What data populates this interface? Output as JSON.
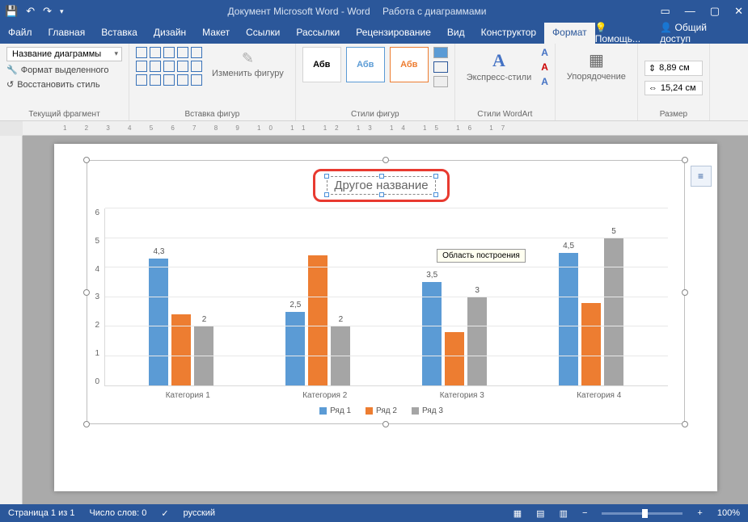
{
  "titlebar": {
    "doc_title": "Документ Microsoft Word - Word",
    "chart_tools": "Работа с диаграммами"
  },
  "tabs": {
    "file": "Файл",
    "home": "Главная",
    "insert": "Вставка",
    "design": "Дизайн",
    "layout": "Макет",
    "references": "Ссылки",
    "mailings": "Рассылки",
    "review": "Рецензирование",
    "view": "Вид",
    "constructor": "Конструктор",
    "format": "Формат",
    "tell_me": "Помощь...",
    "share": "Общий доступ"
  },
  "ribbon": {
    "current_fragment": {
      "selector": "Название диаграммы",
      "format_selection": "Формат выделенного",
      "reset_style": "Восстановить стиль",
      "label": "Текущий фрагмент"
    },
    "insert_shapes": {
      "change_shape": "Изменить фигуру",
      "label": "Вставка фигур"
    },
    "shape_styles": {
      "sample": "Абв",
      "label": "Стили фигур"
    },
    "wordart": {
      "express": "Экспресс-стили",
      "label": "Стили WordArt"
    },
    "arrange": {
      "btn": "Упорядочение",
      "label": ""
    },
    "size": {
      "height": "8,89 см",
      "width": "15,24 см",
      "label": "Размер"
    }
  },
  "chart_data": {
    "type": "bar",
    "title": "Другое название",
    "categories": [
      "Категория 1",
      "Категория 2",
      "Категория 3",
      "Категория 4"
    ],
    "series": [
      {
        "name": "Ряд 1",
        "color": "#5b9bd5",
        "values": [
          4.3,
          2.5,
          3.5,
          4.5
        ]
      },
      {
        "name": "Ряд 2",
        "color": "#ed7d31",
        "values": [
          2.4,
          4.4,
          1.8,
          2.8
        ]
      },
      {
        "name": "Ряд 3",
        "color": "#a5a5a5",
        "values": [
          2,
          2,
          3,
          5
        ]
      }
    ],
    "data_labels": [
      "4,3",
      "2,5",
      "3,5",
      "4,5",
      "2",
      "2",
      "3",
      "5"
    ],
    "ylim": [
      0,
      6
    ],
    "yticks": [
      0,
      1,
      2,
      3,
      4,
      5,
      6
    ],
    "tooltip": "Область построения"
  },
  "statusbar": {
    "page": "Страница 1 из 1",
    "words": "Число слов: 0",
    "lang": "русский",
    "zoom": "100%"
  }
}
